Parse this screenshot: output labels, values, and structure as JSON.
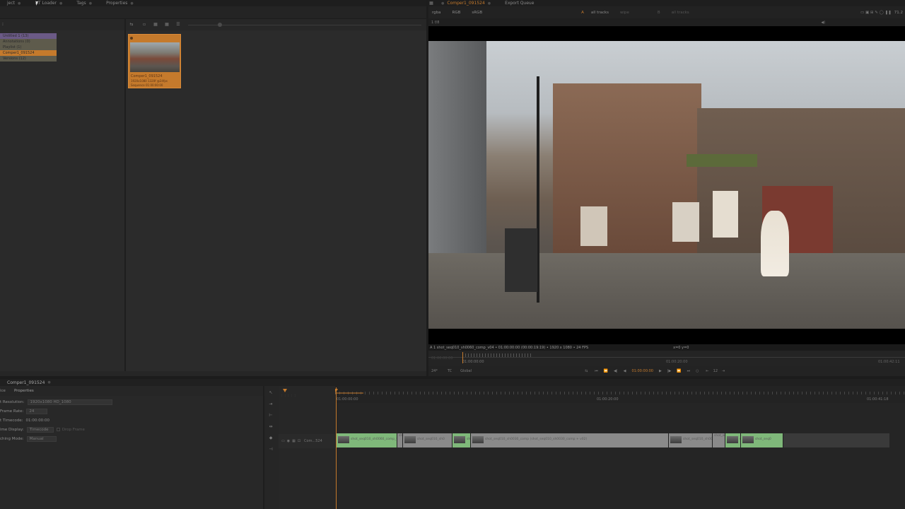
{
  "top_tabs_left": [
    {
      "label": "ject"
    },
    {
      "label": "NT Loader"
    },
    {
      "label": "Tags"
    },
    {
      "label": "Properties"
    }
  ],
  "top_tabs_right": [
    {
      "label": "Comper1_091524",
      "active": true
    },
    {
      "label": "Export Queue",
      "active": false
    }
  ],
  "project_tree": [
    {
      "label": "Untitled 1 (13)",
      "color": "#6b5a86"
    },
    {
      "label": "Annotations (0)",
      "color": "#5e5b4c"
    },
    {
      "label": "Playlist (1)",
      "color": "#5e5b4c"
    },
    {
      "label": "Comper1_091524",
      "color": "#c57a2c"
    },
    {
      "label": "Versions (12)",
      "color": "#5e5b4c"
    }
  ],
  "bin_item": {
    "name": "Comper1_091524",
    "line2": "1920x1080  1320f @24fps",
    "line3": "Sequence        01:00:00:00"
  },
  "viewer": {
    "channels": "rgba",
    "colorspace": "RGB",
    "lut": "sRGB",
    "track_a": "all tracks",
    "wipe": "wipe",
    "track_b": "all tracks",
    "zoom": "71.2",
    "frame_indicator": "1 f/8",
    "info_bar": "A 1 shot_seq010_sh0060_comp_v04 • 01:00:00:00 (00:00:19:19) • 1920 x 1080 • 24 FPS",
    "coords": "x=0 y=0",
    "timeline_start": "01:00:00:00",
    "timeline_mid": "01:00:20:00",
    "timeline_end": "01:00:42:11",
    "timeline_head": "01:00:00:00",
    "fps": "24*",
    "tc_mode": "TC",
    "scope": "Global",
    "current_timecode": "01:00:00:00",
    "frame_step": "12"
  },
  "sequence_panel": {
    "tab_label": "Comper1_091524",
    "sub_tab": "Properties",
    "sub_tab_left": "ice"
  },
  "properties": [
    {
      "label": "t Resolution:",
      "value": "1920x1080 HD_1080"
    },
    {
      "label": "Frame Rate:",
      "value": "24"
    },
    {
      "label": "t Timecode:",
      "value": "01:00:00:00"
    },
    {
      "label": "ime Display:",
      "value": "Timecode",
      "extra": "Drop Frame"
    },
    {
      "label": "ching Mode:",
      "value": "Manual"
    }
  ],
  "timeline": {
    "ruler_start": "01:00:00:00",
    "ruler_mid": "01:00:20:00",
    "ruler_end": "01:00:41:18",
    "track_name": "Com...524"
  },
  "clips": [
    {
      "label": "shot_seq010_sh0060_comp_v04",
      "color": "#7fb87a"
    },
    {
      "label": "shot_seq0",
      "color": "#8a8a8a"
    },
    {
      "label": "shot_seq010_sh0",
      "color": "#8a8a8a"
    },
    {
      "label": "shot",
      "color": "#7fb87a"
    },
    {
      "label": "shot_seq010_sh0030_comp (shot_seq010_sh0030_comp + v02)",
      "color": "#8a8a8a"
    },
    {
      "label": "shot_seq010_sh0070_comp",
      "color": "#8a8a8a"
    },
    {
      "label": "shot_seq0",
      "color": "#8a8a8a"
    },
    {
      "label": "shot",
      "color": "#7fb87a"
    },
    {
      "label": "shot_seq0",
      "color": "#7fb87a"
    }
  ],
  "colors": {
    "accent": "#c57a2c",
    "clip_green": "#7fb87a",
    "clip_gray": "#8a8a8a",
    "playhead": "#c57a2c"
  }
}
